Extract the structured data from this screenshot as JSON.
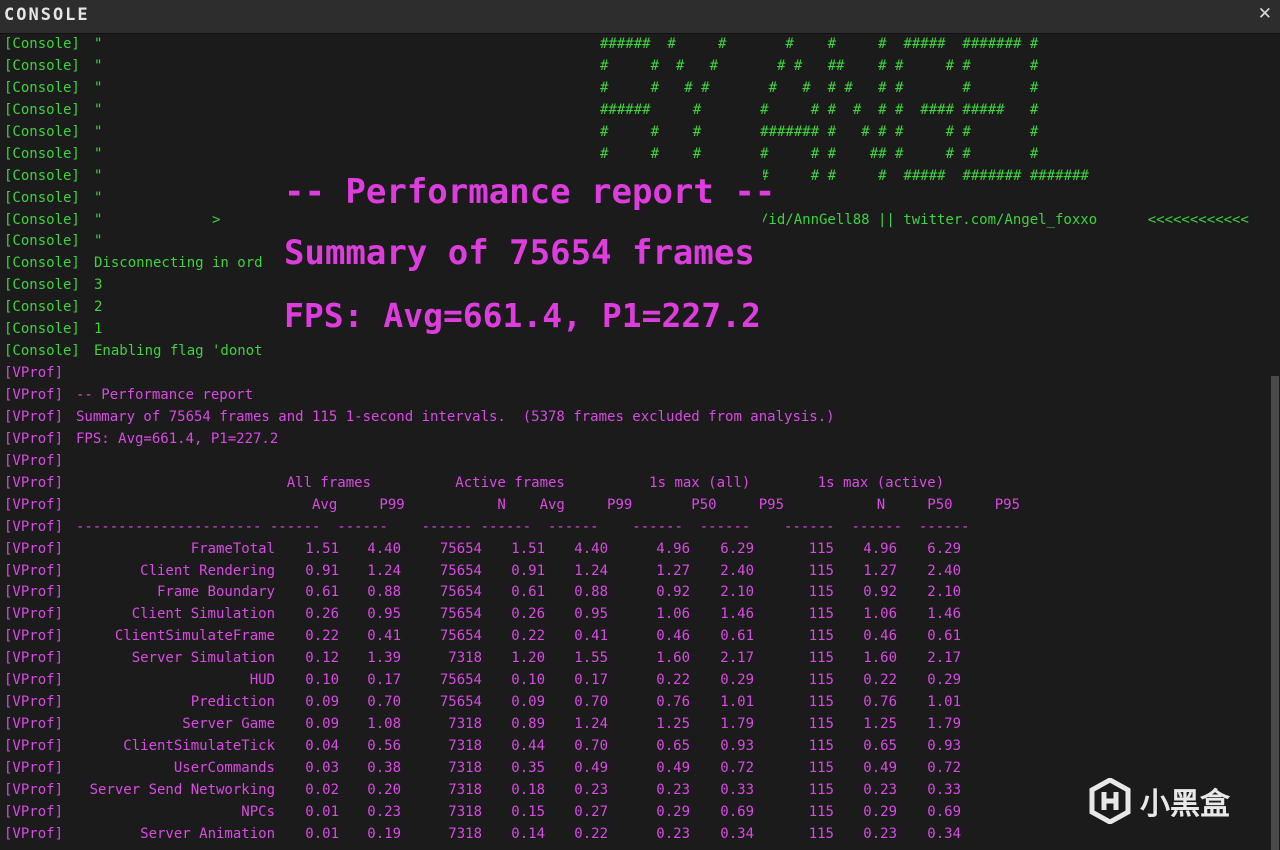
{
  "window": {
    "title": "CONSOLE",
    "close_glyph": "✕"
  },
  "colors": {
    "green": "#3cd33c",
    "magenta": "#d94ae3",
    "background": "#1b1b1b"
  },
  "console_lines": [
    {
      "prefix": "[Console]",
      "text": "\"",
      "art": "######  #     #       #    #     #  #####  ####### #"
    },
    {
      "prefix": "[Console]",
      "text": "\"",
      "art": "#     #  #   #       # #   ##    # #     # #       #"
    },
    {
      "prefix": "[Console]",
      "text": "\"",
      "art": "#     #   # #       #   #  # #   # #       #       #"
    },
    {
      "prefix": "[Console]",
      "text": "\"",
      "art": "######     #       #     # #  #  # #  #### #####   #"
    },
    {
      "prefix": "[Console]",
      "text": "\"",
      "art": "#     #    #       ####### #   # # #     # #       #"
    },
    {
      "prefix": "[Console]",
      "text": "\"",
      "art": "#     #    #       #     # #    ## #     # #       #"
    },
    {
      "prefix": "[Console]",
      "text": "\"",
      "art": "                   #     # #     #  #####  ####### #######"
    },
    {
      "prefix": "[Console]",
      "text": "\"",
      "art": ""
    },
    {
      "prefix": "[Console]",
      "text": "\"             >",
      "art": "",
      "link": "/id/AnnGell88 || twitter.com/Angel_foxxo      <<<<<<<<<<<<"
    },
    {
      "prefix": "[Console]",
      "text": "\"",
      "art": ""
    },
    {
      "prefix": "[Console]",
      "text": "Disconnecting in ord",
      "art": ""
    },
    {
      "prefix": "[Console]",
      "text": "3",
      "art": ""
    },
    {
      "prefix": "[Console]",
      "text": "2",
      "art": ""
    },
    {
      "prefix": "[Console]",
      "text": "1",
      "art": ""
    },
    {
      "prefix": "[Console]",
      "text": "Enabling flag 'donot",
      "art": ""
    }
  ],
  "vprof_lines": [
    {
      "prefix": "[VProf]",
      "text": ""
    },
    {
      "prefix": "[VProf]",
      "text": "-- Performance report"
    },
    {
      "prefix": "[VProf]",
      "text": "Summary of 75654 frames and 115 1-second intervals.  (5378 frames excluded from analysis.)"
    },
    {
      "prefix": "[VProf]",
      "text": "FPS: Avg=661.4, P1=227.2"
    },
    {
      "prefix": "[VProf]",
      "text": ""
    },
    {
      "prefix": "[VProf]",
      "text": "                         All frames          Active frames          1s max (all)        1s max (active)"
    },
    {
      "prefix": "[VProf]",
      "text": "                            Avg     P99           N    Avg     P99       P50     P95           N     P50     P95"
    },
    {
      "prefix": "[VProf]",
      "text": "---------------------- ------  ------    ------ ------  ------    ------  ------    ------  ------  ------"
    }
  ],
  "table_rows": [
    {
      "name": "FrameTotal",
      "avg": "1.51",
      "p99": "4.40",
      "n": "75654",
      "aavg": "1.51",
      "ap99": "4.40",
      "p50": "4.96",
      "p95": "6.29",
      "an": "115",
      "ap50": "4.96",
      "ap95": "6.29"
    },
    {
      "name": "Client Rendering",
      "avg": "0.91",
      "p99": "1.24",
      "n": "75654",
      "aavg": "0.91",
      "ap99": "1.24",
      "p50": "1.27",
      "p95": "2.40",
      "an": "115",
      "ap50": "1.27",
      "ap95": "2.40"
    },
    {
      "name": "Frame Boundary",
      "avg": "0.61",
      "p99": "0.88",
      "n": "75654",
      "aavg": "0.61",
      "ap99": "0.88",
      "p50": "0.92",
      "p95": "2.10",
      "an": "115",
      "ap50": "0.92",
      "ap95": "2.10"
    },
    {
      "name": "Client Simulation",
      "avg": "0.26",
      "p99": "0.95",
      "n": "75654",
      "aavg": "0.26",
      "ap99": "0.95",
      "p50": "1.06",
      "p95": "1.46",
      "an": "115",
      "ap50": "1.06",
      "ap95": "1.46"
    },
    {
      "name": "ClientSimulateFrame",
      "avg": "0.22",
      "p99": "0.41",
      "n": "75654",
      "aavg": "0.22",
      "ap99": "0.41",
      "p50": "0.46",
      "p95": "0.61",
      "an": "115",
      "ap50": "0.46",
      "ap95": "0.61"
    },
    {
      "name": "Server Simulation",
      "avg": "0.12",
      "p99": "1.39",
      "n": "7318",
      "aavg": "1.20",
      "ap99": "1.55",
      "p50": "1.60",
      "p95": "2.17",
      "an": "115",
      "ap50": "1.60",
      "ap95": "2.17"
    },
    {
      "name": "HUD",
      "avg": "0.10",
      "p99": "0.17",
      "n": "75654",
      "aavg": "0.10",
      "ap99": "0.17",
      "p50": "0.22",
      "p95": "0.29",
      "an": "115",
      "ap50": "0.22",
      "ap95": "0.29"
    },
    {
      "name": "Prediction",
      "avg": "0.09",
      "p99": "0.70",
      "n": "75654",
      "aavg": "0.09",
      "ap99": "0.70",
      "p50": "0.76",
      "p95": "1.01",
      "an": "115",
      "ap50": "0.76",
      "ap95": "1.01"
    },
    {
      "name": "Server Game",
      "avg": "0.09",
      "p99": "1.08",
      "n": "7318",
      "aavg": "0.89",
      "ap99": "1.24",
      "p50": "1.25",
      "p95": "1.79",
      "an": "115",
      "ap50": "1.25",
      "ap95": "1.79"
    },
    {
      "name": "ClientSimulateTick",
      "avg": "0.04",
      "p99": "0.56",
      "n": "7318",
      "aavg": "0.44",
      "ap99": "0.70",
      "p50": "0.65",
      "p95": "0.93",
      "an": "115",
      "ap50": "0.65",
      "ap95": "0.93"
    },
    {
      "name": "UserCommands",
      "avg": "0.03",
      "p99": "0.38",
      "n": "7318",
      "aavg": "0.35",
      "ap99": "0.49",
      "p50": "0.49",
      "p95": "0.72",
      "an": "115",
      "ap50": "0.49",
      "ap95": "0.72"
    },
    {
      "name": "Server Send Networking",
      "avg": "0.02",
      "p99": "0.20",
      "n": "7318",
      "aavg": "0.18",
      "ap99": "0.23",
      "p50": "0.23",
      "p95": "0.33",
      "an": "115",
      "ap50": "0.23",
      "ap95": "0.33"
    },
    {
      "name": "NPCs",
      "avg": "0.01",
      "p99": "0.23",
      "n": "7318",
      "aavg": "0.15",
      "ap99": "0.27",
      "p50": "0.29",
      "p95": "0.69",
      "an": "115",
      "ap50": "0.29",
      "ap95": "0.69"
    },
    {
      "name": "Server Animation",
      "avg": "0.01",
      "p99": "0.19",
      "n": "7318",
      "aavg": "0.14",
      "ap99": "0.22",
      "p50": "0.23",
      "p95": "0.34",
      "an": "115",
      "ap50": "0.23",
      "ap95": "0.34"
    }
  ],
  "overlay": {
    "heading": "-- Performance report --",
    "summary": "Summary of 75654 frames and 11",
    "fps": "FPS: Avg=661.4, P1=227.2"
  },
  "watermark": {
    "text": "小黑盒",
    "icon": "heybox-logo-icon"
  }
}
